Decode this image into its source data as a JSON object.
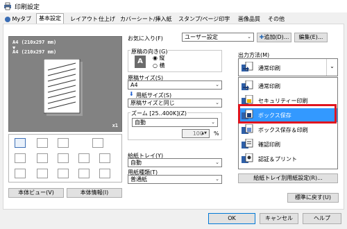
{
  "window": {
    "title": "印刷設定"
  },
  "tabs": [
    {
      "label": "Myタブ"
    },
    {
      "label": "基本設定"
    },
    {
      "label": "レイアウト"
    },
    {
      "label": "仕上げ"
    },
    {
      "label": "カバーシート/挿入紙"
    },
    {
      "label": "スタンプ/ページ印字"
    },
    {
      "label": "画像品質"
    },
    {
      "label": "その他"
    }
  ],
  "preview": {
    "line1": "A4 (210x297 mm)",
    "line2": "A4 (210x297 mm)",
    "copies": "x1"
  },
  "left_buttons": {
    "preview": "本体ビュー(V)",
    "info": "本体情報(I)"
  },
  "favorites": {
    "label": "お気に入り(F)",
    "value": "ユーザー設定",
    "add": "追加(D)...",
    "edit": "編集(E)..."
  },
  "orientation": {
    "label": "原稿の向き(G)",
    "portrait": "縦",
    "landscape": "横"
  },
  "paper": {
    "original_size_label": "原稿サイズ(S)",
    "original_size_value": "A4",
    "paper_size_label": "用紙サイズ(S)",
    "paper_size_value": "原稿サイズと同じ",
    "zoom_label": "ズーム [25..400K](Z)",
    "zoom_value": "自動",
    "zoom_number": "100",
    "zoom_unit": "%"
  },
  "tray": {
    "label": "給紙トレイ(Y)",
    "value": "自動"
  },
  "paper_type": {
    "label": "用紙種類(T)",
    "value": "普通紙"
  },
  "output": {
    "label": "出力方法(M)",
    "selected": "通常印刷",
    "options": [
      {
        "label": "通常印刷"
      },
      {
        "label": "セキュリティー印刷"
      },
      {
        "label": "ボックス保存"
      },
      {
        "label": "ボックス保存＆印刷"
      },
      {
        "label": "確認印刷"
      },
      {
        "label": "認証＆プリント"
      }
    ]
  },
  "tray_paper_button": "給紙トレイ別用紙設定(R)...",
  "reset_button": "標準に戻す(U)",
  "footer": {
    "ok": "OK",
    "cancel": "キャンセル",
    "help": "ヘルプ"
  },
  "colors": {
    "highlight": "#3399ff",
    "red_box": "#e0141e",
    "preview_bg": "#828282"
  }
}
